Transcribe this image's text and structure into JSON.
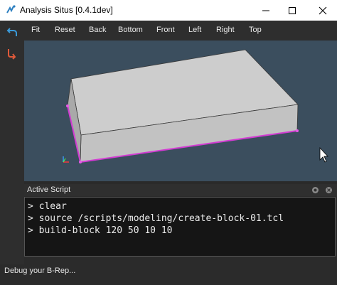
{
  "window": {
    "title": "Analysis Situs [0.4.1dev]",
    "app_icon": "analysis-situs-logo-icon",
    "controls": [
      "minimize-icon",
      "maximize-icon",
      "close-icon"
    ]
  },
  "left_toolbar": {
    "items": [
      {
        "icon": "undo-arrow-icon",
        "color": "#3a9ad9"
      },
      {
        "icon": "redo-arrow-icon",
        "color": "#e05a3a"
      }
    ]
  },
  "view_toolbar": {
    "buttons": [
      "Fit",
      "Reset",
      "Back",
      "Bottom",
      "Front",
      "Left",
      "Right",
      "Top"
    ]
  },
  "viewport": {
    "background": "#3b4e5e",
    "shape": "block",
    "edge_highlight": "#d23cd2",
    "axis_icon": "axis-triad-icon"
  },
  "script_panel": {
    "title": "Active Script",
    "lines": [
      "> clear",
      "> source /scripts/modeling/create-block-01.tcl",
      "> build-block 120 50 10 10"
    ]
  },
  "status": {
    "text": "Debug your B-Rep..."
  }
}
